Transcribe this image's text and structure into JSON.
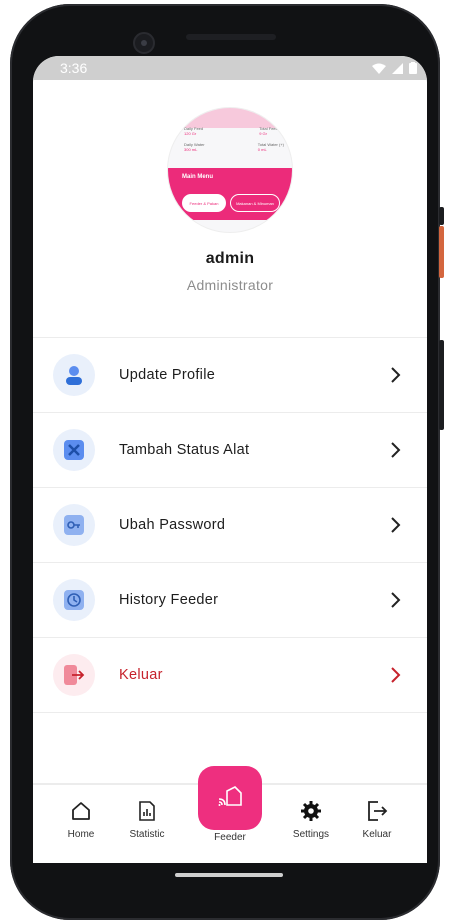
{
  "status_bar": {
    "time": "3:36"
  },
  "profile": {
    "name": "admin",
    "role": "Administrator",
    "avatar_preview": {
      "stat1_label": "Daily Feed",
      "stat1_value": "120 Gr",
      "stat2_label": "Total Feed (+)",
      "stat2_value": "9 Gr",
      "stat3_label": "Daily Water",
      "stat3_value": "300 mL",
      "stat4_label": "Total Water (+)",
      "stat4_value": "0 mL",
      "menu_title": "Main Menu",
      "btn1": "Feeder & Pakan",
      "btn2": "Makanan & Minuman"
    }
  },
  "menu": [
    {
      "label": "Update Profile",
      "icon": "user-icon"
    },
    {
      "label": "Tambah Status Alat",
      "icon": "tools-icon"
    },
    {
      "label": "Ubah Password",
      "icon": "key-icon"
    },
    {
      "label": "History Feeder",
      "icon": "history-icon"
    },
    {
      "label": "Keluar",
      "icon": "logout-icon"
    }
  ],
  "nav": {
    "home": "Home",
    "statistic": "Statistic",
    "feeder": "Feeder",
    "settings": "Settings",
    "keluar": "Keluar"
  },
  "colors": {
    "accent": "#ee2f7f",
    "icon_blue": "#5b8def",
    "danger": "#c6222c"
  }
}
